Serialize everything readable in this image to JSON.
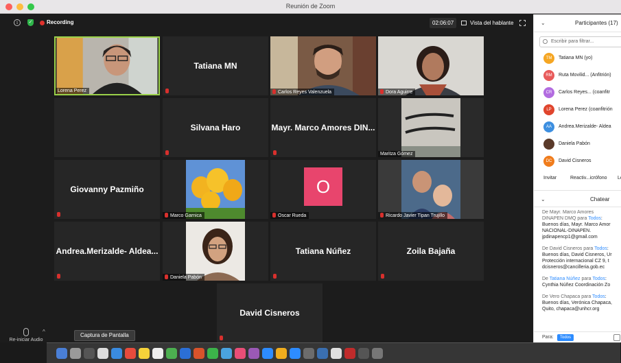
{
  "window": {
    "title": "Reunión de Zoom"
  },
  "topbar": {
    "recording_label": "Recording",
    "timer": "02:06:07",
    "view_label": "Vista del hablante"
  },
  "tiles": {
    "lorena": "Lorena Perez",
    "tatiana_mn": "Tatiana MN",
    "carlos": "Carlos Reyes Valenzuela",
    "dora": "Dora Aguirre",
    "silvana": "Silvana Haro",
    "marco_amores": "Mayr. Marco Amores DIN...",
    "maritza": "Maritza Gómez",
    "giovanny": "Giovanny Pazmiño",
    "marco_garnica": "Marco Garnica",
    "oscar": "Oscar Rueda",
    "oscar_avatar": "O",
    "ricardo": "Ricardo Javier Tipan Trujillo",
    "andrea": "Andrea.Merizalde- Aldea...",
    "daniela": "Daniela Pabón",
    "tatiana_nunez": "Tatiana Núñez",
    "zoila": "Zoila Bajaña",
    "david": "David Cisneros"
  },
  "tooltip": "Captura de Pantalla",
  "bottom": {
    "reiniciar": "Re-iniciar Audio"
  },
  "panel": {
    "title": "Participantes (17)",
    "filter_placeholder": "Escribir para filtrar...",
    "participants": [
      {
        "initials": "TM",
        "name": "Tatiana MN (yo)",
        "color": "#f5a623"
      },
      {
        "initials": "RM",
        "name": "Ruta Movilid... (Anfitrión)",
        "color": "#e85a5a"
      },
      {
        "initials": "CR",
        "name": "Carlos Reyes... (coanfitr",
        "color": "#b26ce0"
      },
      {
        "initials": "LP",
        "name": "Lorena Perez (coanfitrión",
        "color": "#e0452d"
      },
      {
        "initials": "AA",
        "name": "Andrea.Merizalde- Aldea",
        "color": "#3d8fe0"
      },
      {
        "initials": "",
        "name": "Daniela Pabón",
        "color": "#5a3a2a"
      },
      {
        "initials": "DC",
        "name": "David Cisneros",
        "color": "#f07c1c"
      }
    ],
    "invite": "Invitar",
    "reactivate": "Reactiv...icrófono",
    "more": "Le"
  },
  "chat": {
    "title": "Chatear",
    "messages": [
      {
        "from": "De Mayr. Marco Amores",
        "from2": "DINAPEN DMQ para",
        "to": "Todos",
        "lines": [
          "Buenos días, Mayr. Marco Amor",
          "NACIONAL-DINAPEN.",
          "jpdinapencp1@gmail.com"
        ]
      },
      {
        "from": "De David Cisneros para",
        "to": "Todos",
        "lines": [
          "Buenos días, David Cisneros, Ur",
          "Protección internacional CZ 9, t",
          "dcisneros@cancilleria.gob.ec"
        ]
      },
      {
        "from": "De",
        "from_name": "Tatiana Núñez",
        "from_mid": "para",
        "to": "Todos",
        "lines": [
          "Cynthia Núñez Coordinación Zo"
        ]
      },
      {
        "from": "De Vero Chapaca para",
        "to": "Todos",
        "lines": [
          "Buenos días, Verónica Chapaca,",
          "Quito, chapaca@unhcr.org"
        ]
      }
    ],
    "to_label": "Para:",
    "to_value": "Todos"
  }
}
